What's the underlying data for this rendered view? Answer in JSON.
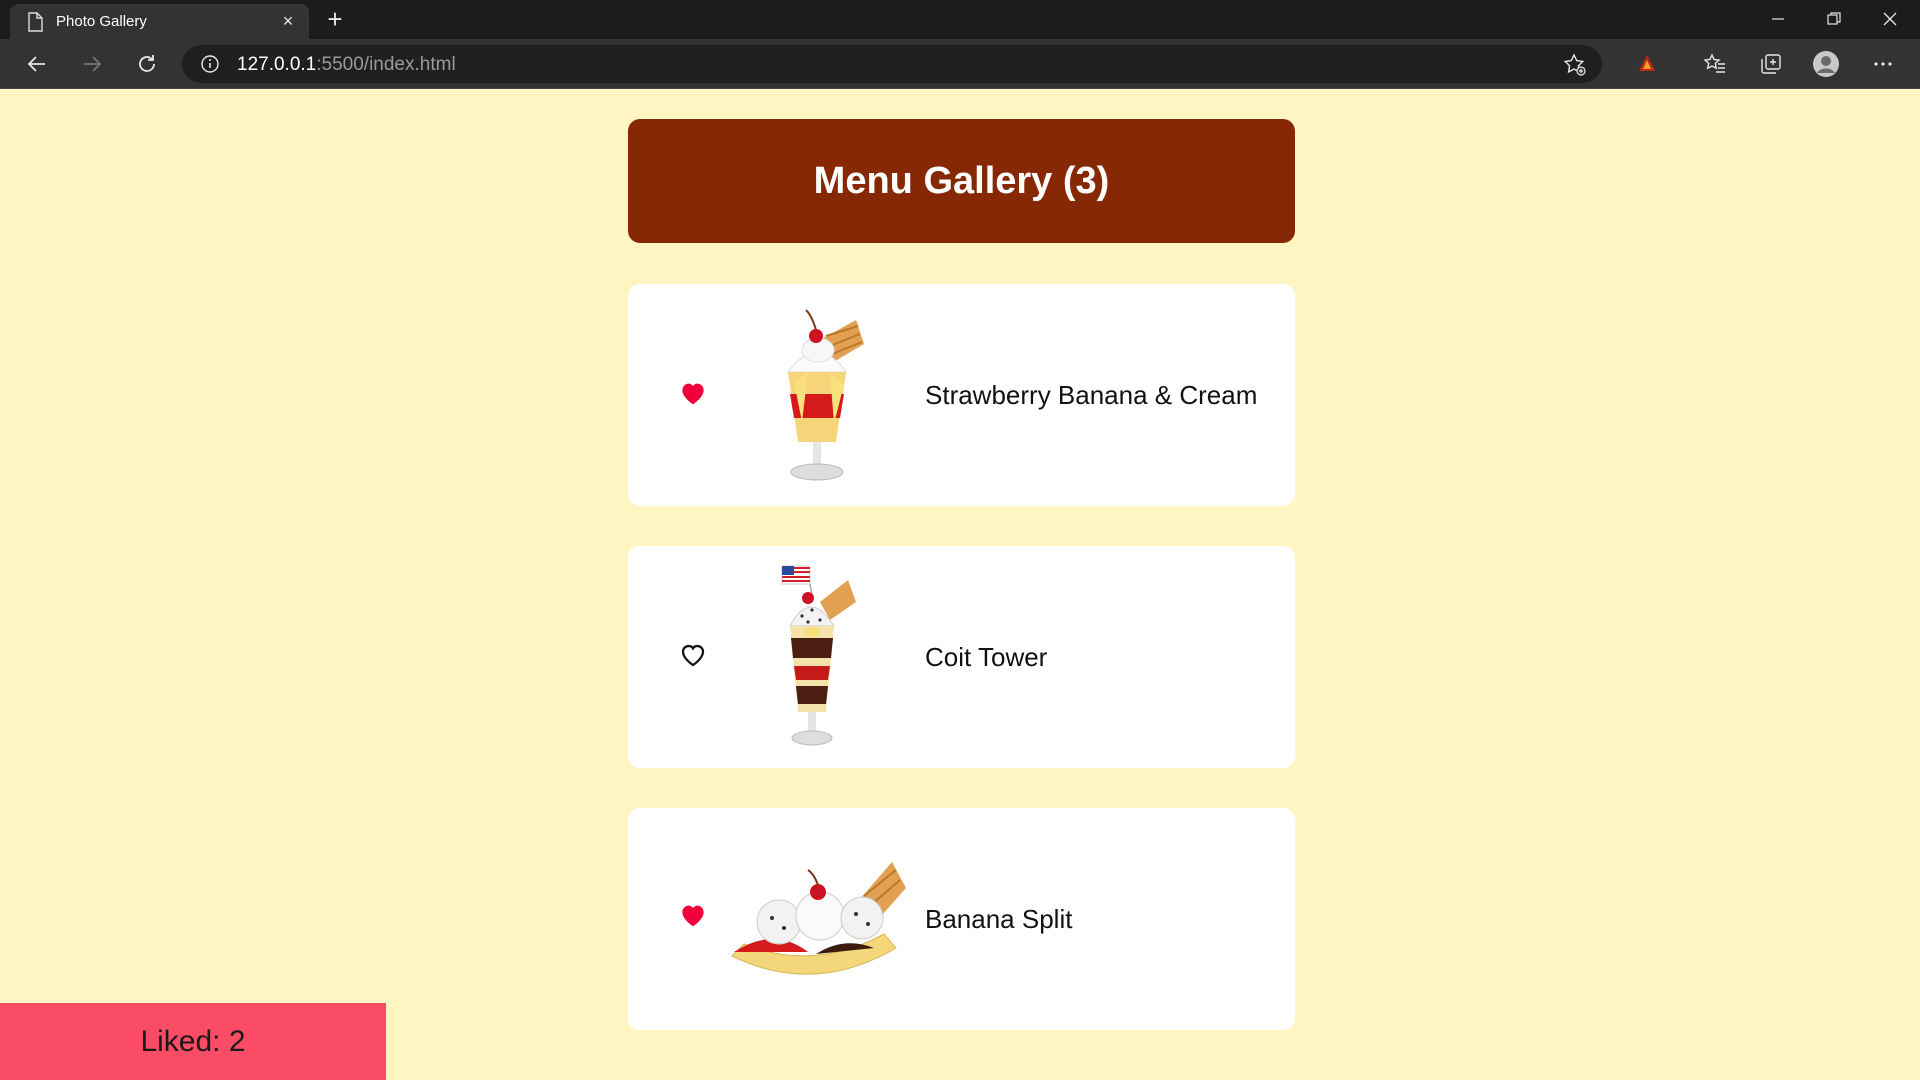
{
  "browser": {
    "tab_title": "Photo Gallery",
    "new_tab_symbol": "+",
    "close_tab_symbol": "×",
    "url_host": "127.0.0.1",
    "url_rest": ":5500/index.html"
  },
  "gallery": {
    "title": "Menu Gallery (3)",
    "items": [
      {
        "name": "Strawberry Banana & Cream",
        "liked": true,
        "image": "strawberry-sundae"
      },
      {
        "name": "Coit Tower",
        "liked": false,
        "image": "tall-parfait-with-flag"
      },
      {
        "name": "Banana Split",
        "liked": true,
        "image": "banana-split-boat"
      }
    ]
  },
  "footer": {
    "liked_label": "Liked: 2"
  },
  "colors": {
    "page_background": "#fff5c2",
    "header_background": "#862804",
    "heart_liked": "#f2003c",
    "liked_bar": "#fb4c65"
  }
}
